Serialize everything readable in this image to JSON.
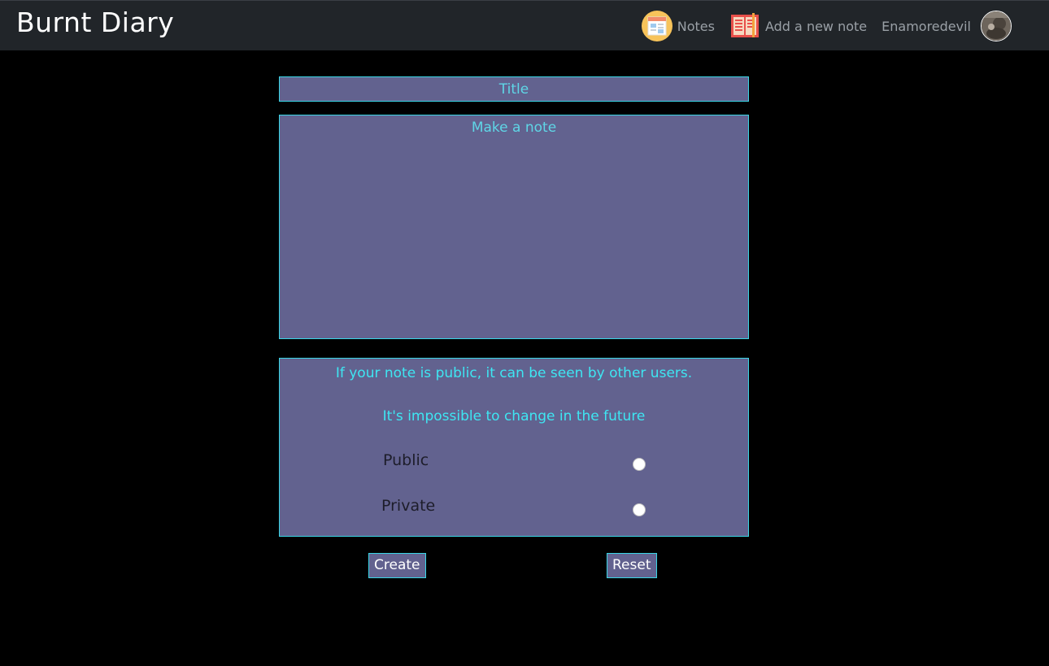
{
  "navbar": {
    "brand": "Burnt Diary",
    "links": [
      {
        "label": "Notes",
        "icon": "notes-newspaper-icon"
      },
      {
        "label": "Add a new note",
        "icon": "open-book-icon"
      }
    ],
    "username": "Enamoredevil",
    "avatar_icon": "user-avatar-photo"
  },
  "form": {
    "title_placeholder": "Title",
    "note_placeholder": "Make a note",
    "visibility": {
      "info_line_1": "If your note is public, it can be seen by other users.",
      "info_line_2": "It's impossible to change in the future",
      "options": [
        {
          "label": "Public",
          "checked": false
        },
        {
          "label": "Private",
          "checked": false
        }
      ]
    },
    "create_label": "Create",
    "reset_label": "Reset"
  },
  "colors": {
    "background": "#000000",
    "navbar": "#212529",
    "panel": "#62628f",
    "border": "#3ad6e6",
    "accent_text": "#3ee6f2"
  }
}
